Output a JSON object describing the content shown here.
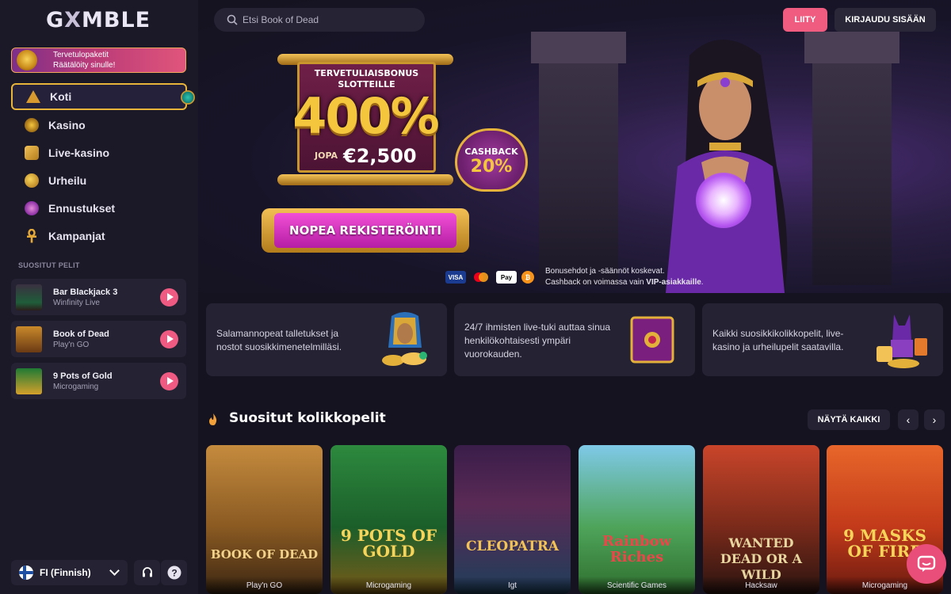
{
  "app": {
    "logo_main": "G",
    "logo_x": "X",
    "logo_rest": "MBLE"
  },
  "sidebar": {
    "welcome": {
      "line1": "Tervetulopaketit",
      "line2": "Räätälöity sinulle!"
    },
    "nav": [
      {
        "label": "Koti",
        "icon": "pyramid-icon",
        "active": true
      },
      {
        "label": "Kasino",
        "icon": "casino-chip-icon"
      },
      {
        "label": "Live-kasino",
        "icon": "dice-icon"
      },
      {
        "label": "Urheilu",
        "icon": "ball-icon"
      },
      {
        "label": "Ennustukset",
        "icon": "trend-icon"
      },
      {
        "label": "Kampanjat",
        "icon": "ankh-icon"
      }
    ],
    "popular_label": "SUOSITUT PELIT",
    "popular_games": [
      {
        "name": "Bar Blackjack 3",
        "provider": "Winfinity Live"
      },
      {
        "name": "Book of Dead",
        "provider": "Play'n GO"
      },
      {
        "name": "9 Pots of Gold",
        "provider": "Microgaming"
      }
    ],
    "language": "FI (Finnish)"
  },
  "header": {
    "search_placeholder": "Etsi Book of Dead",
    "join_label": "LIITY",
    "login_label": "KIRJAUDU SISÄÄN"
  },
  "hero": {
    "bonus_title_1": "TERVETULIAISBONUS",
    "bonus_title_2": "SLOTTEILLE",
    "bonus_percent": "400%",
    "up_to": "JOPA",
    "amount": "€2,500",
    "cashback_label": "CASHBACK",
    "cashback_value": "20%",
    "register_label": "NOPEA REKISTERÖINTI",
    "payments": [
      "VISA",
      "Mastercard",
      "Apple Pay",
      "Bitcoin"
    ],
    "terms_line1": "Bonusehdot ja -säännöt koskevat.",
    "terms_line2_pre": "Cashback on voimassa vain ",
    "terms_line2_bold": "VIP-asiakkaille",
    "terms_line2_post": "."
  },
  "features": [
    {
      "text": "Salamannopeat talletukset ja nostot suosikkimenetelmilläsi."
    },
    {
      "text": "24/7 ihmisten live-tuki auttaa sinua henkilökohtaisesti ympäri vuorokauden."
    },
    {
      "text": "Kaikki suosikkikolikkopelit, live-kasino ja urheilupelit saatavilla."
    }
  ],
  "slots_section": {
    "title": "Suositut kolikkopelit",
    "view_all": "NÄYTÄ KAIKKI",
    "prev": "‹",
    "next": "›",
    "games": [
      {
        "title": "BOOK OF DEAD",
        "provider": "Play'n GO"
      },
      {
        "title": "9 POTS OF GOLD",
        "provider": "Microgaming"
      },
      {
        "title": "CLEOPATRA",
        "provider": "Igt"
      },
      {
        "title": "Rainbow Riches",
        "provider": "Scientific Games"
      },
      {
        "title": "WANTED DEAD OR A WILD",
        "provider": "Hacksaw"
      },
      {
        "title": "9 MASKS OF FIRE",
        "provider": "Microgaming"
      }
    ]
  },
  "colors": {
    "accent": "#f05c80",
    "gold": "#f4c63e",
    "panel": "#242233",
    "bg": "#15131f"
  }
}
